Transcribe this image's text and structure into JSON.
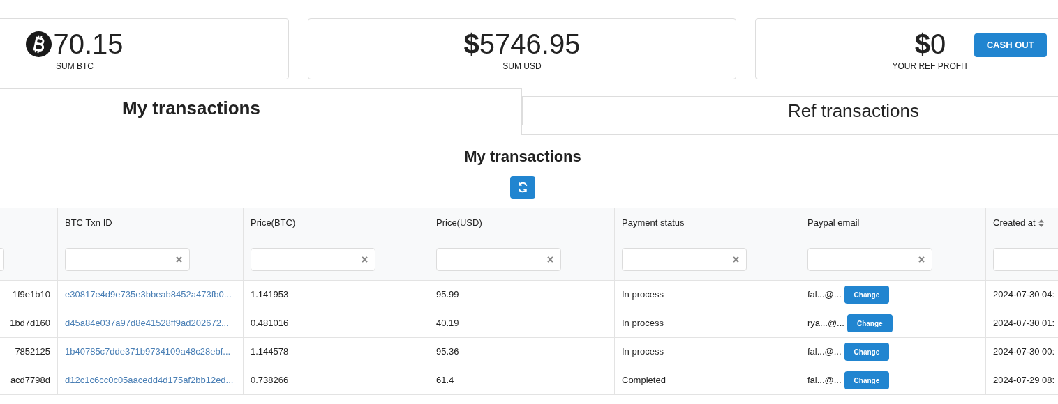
{
  "stats": [
    {
      "kind": "btc",
      "value": "70.15",
      "label": "SUM BTC"
    },
    {
      "kind": "usd",
      "symbol": "$",
      "value": "5746.95",
      "label": "SUM USD"
    },
    {
      "kind": "usd",
      "symbol": "$",
      "value": "0",
      "label": "YOUR REF PROFIT",
      "action": "CASH OUT"
    }
  ],
  "tabs": [
    {
      "label": "My transactions",
      "selected": true
    },
    {
      "label": "Ref transactions",
      "selected": false
    }
  ],
  "section_title": "My transactions",
  "table": {
    "columns": [
      {
        "label": "BTC Txn ID",
        "sortable": false
      },
      {
        "label": "Price(BTC)",
        "sortable": false
      },
      {
        "label": "Price(USD)",
        "sortable": false
      },
      {
        "label": "Payment status",
        "sortable": false
      },
      {
        "label": "Paypal email",
        "sortable": false
      },
      {
        "label": "Created at",
        "sortable": true
      }
    ],
    "rows": [
      {
        "column_1": "1f9e1b10",
        "btc_txn_id": "e30817e4d9e735e3bbeab8452a473fb0...",
        "price_btc": "1.141953",
        "price_usd": "95.99",
        "payment_status": "In process",
        "paypal_email": "fal...@...",
        "email_action": "Change",
        "created_at": "2024-07-30 04:"
      },
      {
        "column_1": "1bd7d160",
        "btc_txn_id": "d45a84e037a97d8e41528ff9ad202672...",
        "price_btc": "0.481016",
        "price_usd": "40.19",
        "payment_status": "In process",
        "paypal_email": "rya...@...",
        "email_action": "Change",
        "created_at": "2024-07-30 01:"
      },
      {
        "column_1": "7852125",
        "btc_txn_id": "1b40785c7dde371b9734109a48c28ebf...",
        "price_btc": "1.144578",
        "price_usd": "95.36",
        "payment_status": "In process",
        "paypal_email": "fal...@...",
        "email_action": "Change",
        "created_at": "2024-07-30 00:"
      },
      {
        "column_1": "acd7798d",
        "btc_txn_id": "d12c1c6cc0c05aacedd4d175af2bb12ed...",
        "price_btc": "0.738266",
        "price_usd": "61.4",
        "payment_status": "Completed",
        "paypal_email": "fal...@...",
        "email_action": "Change",
        "created_at": "2024-07-29 08:"
      }
    ]
  }
}
